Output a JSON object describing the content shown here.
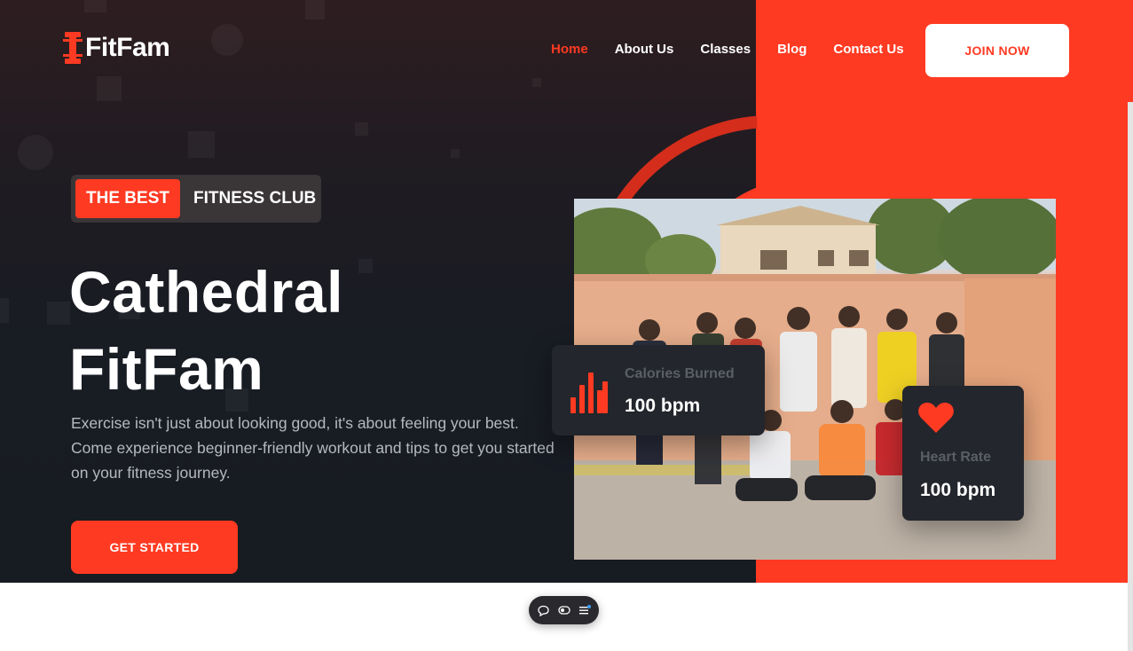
{
  "brand": {
    "name": "FitFam"
  },
  "nav": {
    "items": [
      {
        "label": "Home",
        "active": true
      },
      {
        "label": "About Us"
      },
      {
        "label": "Classes"
      },
      {
        "label": "Blog"
      },
      {
        "label": "Contact Us"
      }
    ],
    "join_label": "JOIN NOW"
  },
  "hero": {
    "tag_highlight": "THE BEST",
    "tag_rest": "FITNESS CLUB",
    "title_line1": "Cathedral",
    "title_line2": "FitFam",
    "description": "Exercise isn't just about looking good, it's about feeling your best. Come experience beginner-friendly workout and tips to get you started on your fitness journey.",
    "cta_label": "GET STARTED"
  },
  "stats": {
    "calories": {
      "label": "Calories Burned",
      "value": "100 bpm",
      "icon": "bar-chart-icon"
    },
    "heart": {
      "label": "Heart Rate",
      "value": "100 bpm",
      "icon": "heart-icon"
    }
  },
  "toolbar": {
    "icons": [
      "comment-icon",
      "toggle-icon",
      "menu-icon"
    ]
  },
  "colors": {
    "accent": "#ff3a22",
    "dark": "#181c23",
    "card": "#23262c"
  }
}
